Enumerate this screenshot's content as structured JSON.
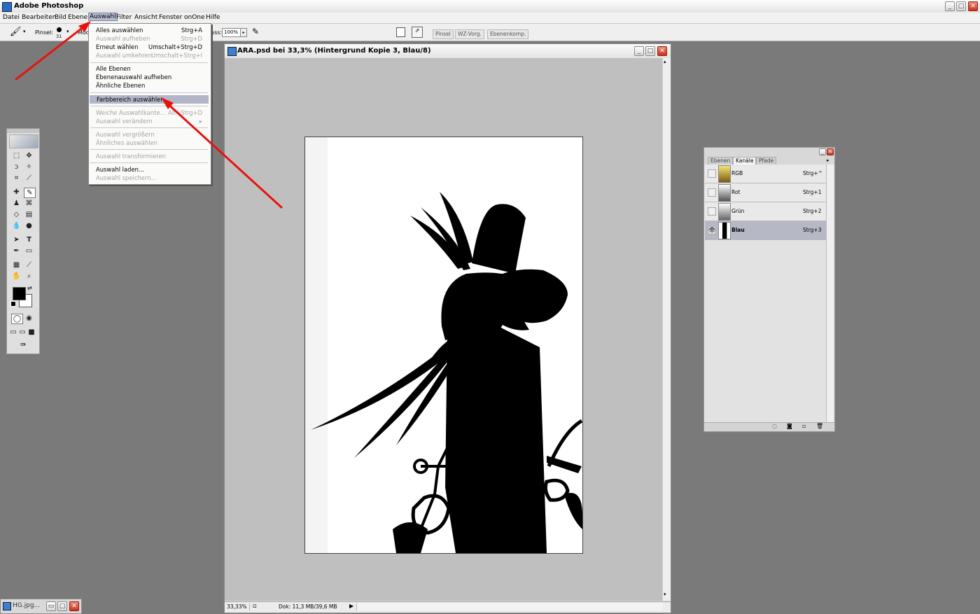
{
  "app": {
    "title": "Adobe Photoshop"
  },
  "menubar": [
    "Datei",
    "Bearbeiten",
    "Bild",
    "Ebene",
    "Auswahl",
    "Filter",
    "Ansicht",
    "Fenster",
    "onOne",
    "Hilfe"
  ],
  "options": {
    "brush_label": "Pinsel:",
    "brush_size": "31",
    "mode_label": "Mod",
    "flow_label": "uss:",
    "flow_value": "100%",
    "panel_tabs": [
      "Pinsel",
      "WZ-Vorg.",
      "Ebenenkomp."
    ]
  },
  "selection_menu": {
    "items": [
      {
        "label": "Alles auswählen",
        "shortcut": "Strg+A",
        "disabled": false
      },
      {
        "label": "Auswahl aufheben",
        "shortcut": "Strg+D",
        "disabled": true
      },
      {
        "label": "Erneut wählen",
        "shortcut": "Umschalt+Strg+D",
        "disabled": false
      },
      {
        "label": "Auswahl umkehren",
        "shortcut": "Umschalt+Strg+I",
        "disabled": true
      },
      {
        "label": "Alle Ebenen",
        "shortcut": "",
        "disabled": false
      },
      {
        "label": "Ebenenauswahl aufheben",
        "shortcut": "",
        "disabled": false
      },
      {
        "label": "Ähnliche Ebenen",
        "shortcut": "",
        "disabled": false
      },
      {
        "label": "Farbbereich auswählen...",
        "shortcut": "",
        "disabled": false,
        "highlighted": true
      },
      {
        "label": "Weiche Auswahlkante...",
        "shortcut": "Alt+Strg+D",
        "disabled": true
      },
      {
        "label": "Auswahl verändern",
        "shortcut": "",
        "disabled": true,
        "submenu": true
      },
      {
        "label": "Auswahl vergrößern",
        "shortcut": "",
        "disabled": true
      },
      {
        "label": "Ähnliches auswählen",
        "shortcut": "",
        "disabled": true
      },
      {
        "label": "Auswahl transformieren",
        "shortcut": "",
        "disabled": true
      },
      {
        "label": "Auswahl laden...",
        "shortcut": "",
        "disabled": false
      },
      {
        "label": "Auswahl speichern...",
        "shortcut": "",
        "disabled": true
      }
    ]
  },
  "document": {
    "title": "ARA.psd bei 33,3% (Hintergrund Kopie 3, Blau/8)",
    "zoom": "33,33%",
    "doc_info": "Dok: 11,3 MB/39,6 MB"
  },
  "channels_panel": {
    "tabs": [
      "Ebenen",
      "Kanäle",
      "Pfade"
    ],
    "active_tab": "Kanäle",
    "channels": [
      {
        "name": "RGB",
        "shortcut": "Strg+^",
        "visible": false,
        "selected": false
      },
      {
        "name": "Rot",
        "shortcut": "Strg+1",
        "visible": false,
        "selected": false
      },
      {
        "name": "Grün",
        "shortcut": "Strg+2",
        "visible": false,
        "selected": false
      },
      {
        "name": "Blau",
        "shortcut": "Strg+3",
        "visible": true,
        "selected": true
      }
    ]
  },
  "minimized_doc": {
    "title": "HG.jpg..."
  },
  "colors": {
    "annotation_arrow": "#e8120c",
    "menu_highlight": "#b2b6c8",
    "selected_channel": "#b6b8c6"
  }
}
